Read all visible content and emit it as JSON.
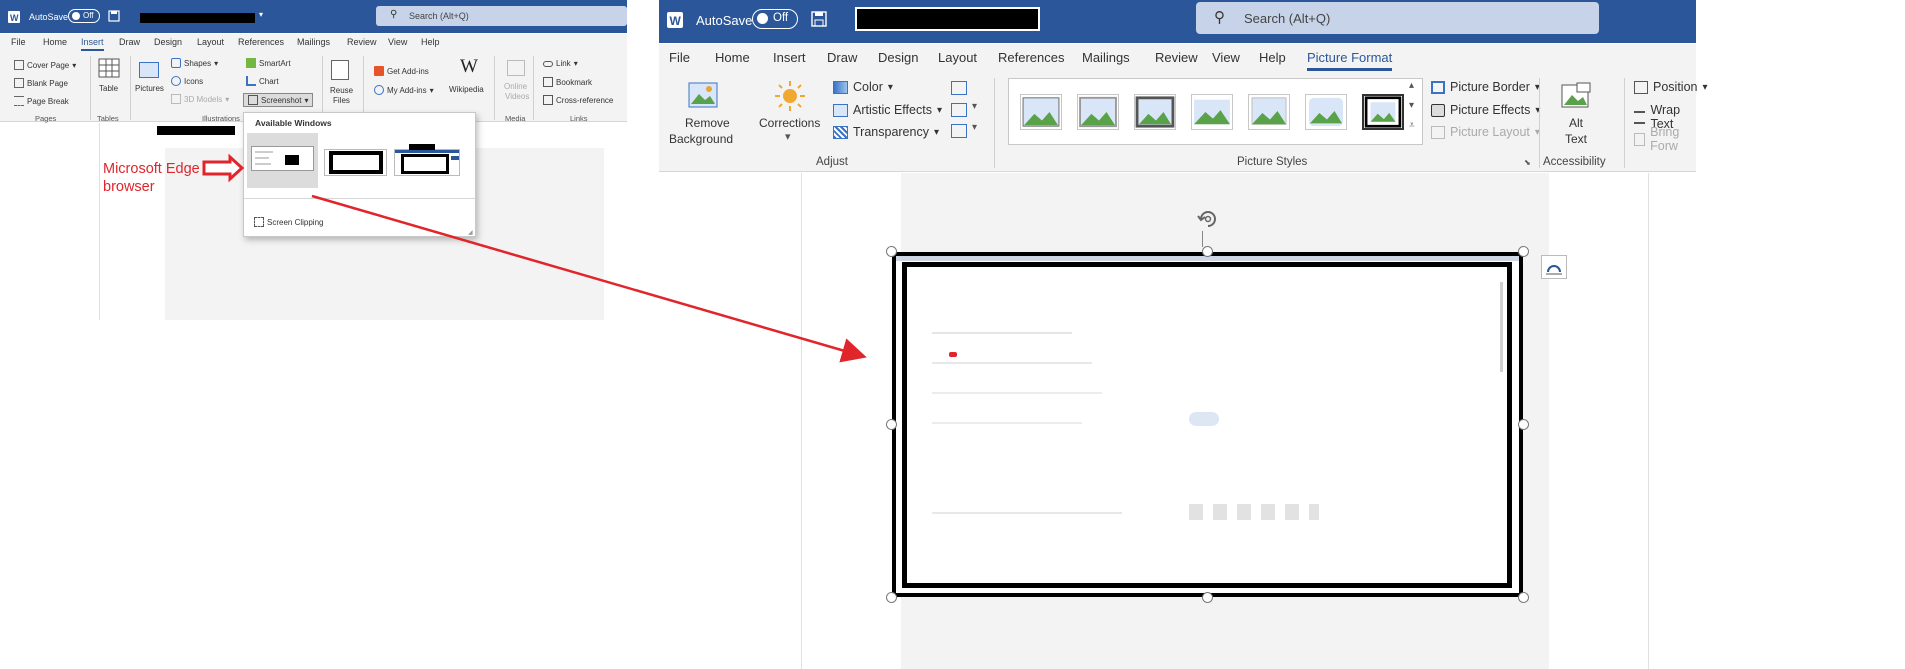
{
  "left": {
    "autosave_label": "AutoSave",
    "autosave_state": "Off",
    "search_placeholder": "Search (Alt+Q)",
    "tabs": [
      "File",
      "Home",
      "Insert",
      "Draw",
      "Design",
      "Layout",
      "References",
      "Mailings",
      "Review",
      "View",
      "Help"
    ],
    "active_tab": "Insert",
    "ribbon": {
      "cover_page": "Cover Page",
      "blank_page": "Blank Page",
      "page_break": "Page Break",
      "group_pages": "Pages",
      "table": "Table",
      "group_tables": "Tables",
      "pictures": "Pictures",
      "shapes": "Shapes",
      "icons": "Icons",
      "models_3d": "3D Models",
      "smartart": "SmartArt",
      "chart": "Chart",
      "screenshot": "Screenshot",
      "group_illustrations": "Illustrations",
      "reuse_files_1": "Reuse",
      "reuse_files_2": "Files",
      "get_addins": "Get Add-ins",
      "my_addins": "My Add-ins",
      "wikipedia": "Wikipedia",
      "online_videos_1": "Online",
      "online_videos_2": "Videos",
      "group_media": "Media",
      "link": "Link",
      "bookmark": "Bookmark",
      "cross_reference": "Cross-reference",
      "group_links": "Links"
    },
    "dropdown": {
      "header": "Available Windows",
      "screen_clipping": "Screen Clipping"
    }
  },
  "annotation": {
    "line1": "Microsoft Edge",
    "line2": "browser"
  },
  "right": {
    "autosave_label": "AutoSave",
    "autosave_state": "Off",
    "search_placeholder": "Search (Alt+Q)",
    "tabs": [
      "File",
      "Home",
      "Insert",
      "Draw",
      "Design",
      "Layout",
      "References",
      "Mailings",
      "Review",
      "View",
      "Help",
      "Picture Format"
    ],
    "active_tab": "Picture Format",
    "ribbon": {
      "remove_background_1": "Remove",
      "remove_background_2": "Background",
      "corrections": "Corrections",
      "color": "Color",
      "artistic_effects": "Artistic Effects",
      "transparency": "Transparency",
      "group_adjust": "Adjust",
      "group_picture_styles": "Picture Styles",
      "picture_border": "Picture Border",
      "picture_effects": "Picture Effects",
      "picture_layout": "Picture Layout",
      "alt_text_1": "Alt",
      "alt_text_2": "Text",
      "group_accessibility": "Accessibility",
      "position": "Position",
      "wrap_text": "Wrap Text",
      "bring_forward": "Bring Forw"
    }
  },
  "colors": {
    "title_bar": "#2b579a",
    "arrow": "#e0252b",
    "ribbon_bg": "#f3f3f3",
    "accent_tab": "#2b579a"
  }
}
